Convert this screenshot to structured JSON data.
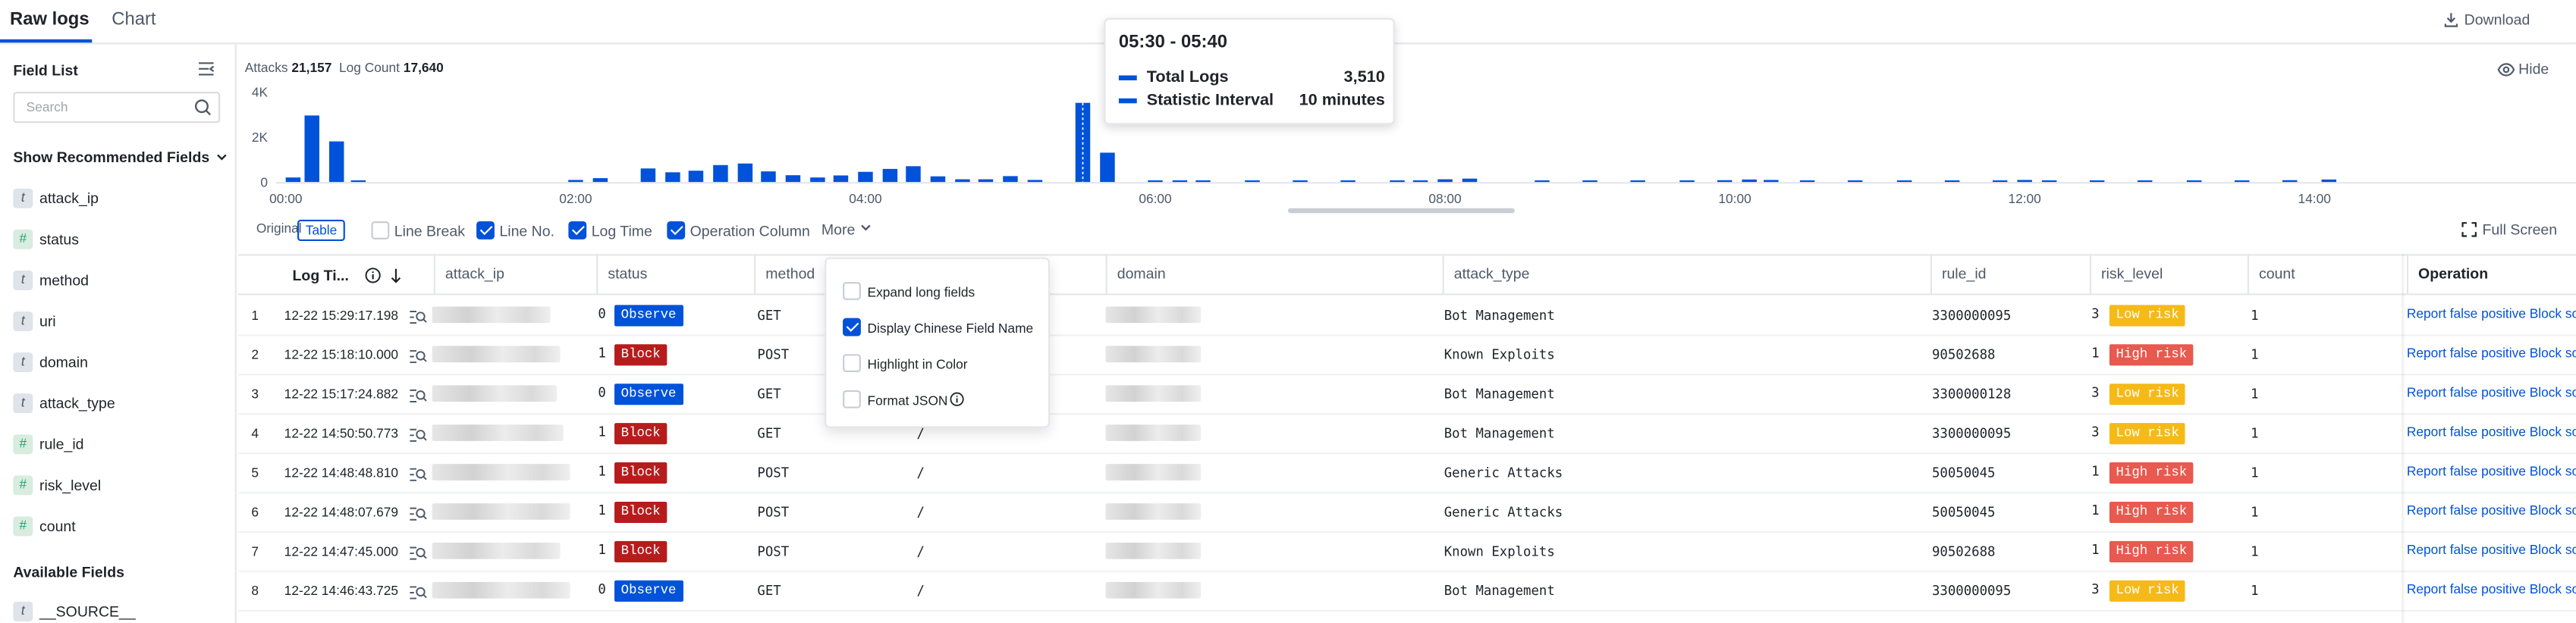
{
  "tabs": [
    {
      "label": "Raw logs",
      "active": true
    },
    {
      "label": "Chart",
      "active": false
    }
  ],
  "download_label": "Download",
  "sidebar": {
    "title": "Field List",
    "search_placeholder": "Search",
    "recommended_title": "Show Recommended Fields",
    "recommended_fields": [
      {
        "name": "attack_ip",
        "type": "t"
      },
      {
        "name": "status",
        "type": "#"
      },
      {
        "name": "method",
        "type": "t"
      },
      {
        "name": "uri",
        "type": "t"
      },
      {
        "name": "domain",
        "type": "t"
      },
      {
        "name": "attack_type",
        "type": "t"
      },
      {
        "name": "rule_id",
        "type": "#"
      },
      {
        "name": "risk_level",
        "type": "#"
      },
      {
        "name": "count",
        "type": "#"
      }
    ],
    "available_title": "Available Fields",
    "available_fields": [
      {
        "name": "__SOURCE__",
        "type": "t"
      }
    ]
  },
  "stats": {
    "attacks_label": "Attacks",
    "attacks_value": "21,157",
    "log_count_label": "Log Count",
    "log_count_value": "17,640"
  },
  "hide_label": "Hide",
  "chart_data": {
    "type": "bar",
    "y_ticks": [
      "4K",
      "2K",
      "0"
    ],
    "ylim": [
      0,
      4000
    ],
    "x_ticks": [
      "00:00",
      "02:00",
      "04:00",
      "06:00",
      "08:00",
      "10:00",
      "12:00",
      "14:00"
    ],
    "bar_color": "#0052d9",
    "highlight_color": "#0052d9",
    "highlight_index": 7,
    "bars": [
      {
        "t": 0.05,
        "v": 200
      },
      {
        "t": 0.18,
        "v": 2950
      },
      {
        "t": 0.35,
        "v": 1800
      },
      {
        "t": 0.5,
        "v": 60
      },
      {
        "t": 2.0,
        "v": 90
      },
      {
        "t": 2.17,
        "v": 170
      },
      {
        "t": 2.5,
        "v": 600
      },
      {
        "t": 2.67,
        "v": 430
      },
      {
        "t": 2.83,
        "v": 500
      },
      {
        "t": 3.0,
        "v": 750
      },
      {
        "t": 3.17,
        "v": 820
      },
      {
        "t": 3.33,
        "v": 470
      },
      {
        "t": 3.5,
        "v": 300
      },
      {
        "t": 3.67,
        "v": 200
      },
      {
        "t": 3.83,
        "v": 290
      },
      {
        "t": 4.0,
        "v": 450
      },
      {
        "t": 4.17,
        "v": 580
      },
      {
        "t": 4.33,
        "v": 700
      },
      {
        "t": 4.5,
        "v": 250
      },
      {
        "t": 4.67,
        "v": 120
      },
      {
        "t": 4.83,
        "v": 120
      },
      {
        "t": 5.0,
        "v": 260
      },
      {
        "t": 5.17,
        "v": 90
      },
      {
        "t": 5.5,
        "v": 3510
      },
      {
        "t": 5.67,
        "v": 1300
      },
      {
        "t": 6.0,
        "v": 70
      },
      {
        "t": 6.17,
        "v": 70
      },
      {
        "t": 6.33,
        "v": 60
      },
      {
        "t": 6.67,
        "v": 50
      },
      {
        "t": 7.0,
        "v": 50
      },
      {
        "t": 7.33,
        "v": 40
      },
      {
        "t": 7.67,
        "v": 40
      },
      {
        "t": 7.83,
        "v": 50
      },
      {
        "t": 8.0,
        "v": 120
      },
      {
        "t": 8.17,
        "v": 150
      },
      {
        "t": 8.67,
        "v": 60
      },
      {
        "t": 9.0,
        "v": 40
      },
      {
        "t": 9.33,
        "v": 40
      },
      {
        "t": 9.67,
        "v": 40
      },
      {
        "t": 9.93,
        "v": 80
      },
      {
        "t": 10.1,
        "v": 110
      },
      {
        "t": 10.25,
        "v": 90
      },
      {
        "t": 10.5,
        "v": 40
      },
      {
        "t": 10.83,
        "v": 40
      },
      {
        "t": 11.17,
        "v": 40
      },
      {
        "t": 11.5,
        "v": 40
      },
      {
        "t": 11.83,
        "v": 60
      },
      {
        "t": 12.0,
        "v": 90
      },
      {
        "t": 12.17,
        "v": 70
      },
      {
        "t": 12.5,
        "v": 40
      },
      {
        "t": 12.83,
        "v": 40
      },
      {
        "t": 13.17,
        "v": 40
      },
      {
        "t": 13.5,
        "v": 40
      },
      {
        "t": 13.83,
        "v": 80
      },
      {
        "t": 14.1,
        "v": 110
      }
    ]
  },
  "tooltip": {
    "title": "05:30 - 05:40",
    "rows": [
      {
        "label": "Total Logs",
        "value": "3,510"
      },
      {
        "label": "Statistic Interval",
        "value": "10 minutes"
      }
    ]
  },
  "toolbar": {
    "view_original": "Original",
    "view_table": "Table",
    "options": [
      {
        "label": "Line Break",
        "checked": false
      },
      {
        "label": "Line No.",
        "checked": true
      },
      {
        "label": "Log Time",
        "checked": true
      },
      {
        "label": "Operation Column",
        "checked": true
      }
    ],
    "more_label": "More",
    "fullscreen_label": "Full Screen"
  },
  "more_menu": [
    {
      "label": "Expand long fields",
      "checked": false
    },
    {
      "label": "Display Chinese Field Name",
      "checked": true
    },
    {
      "label": "Highlight in Color",
      "checked": false
    },
    {
      "label": "Format JSON",
      "checked": false
    }
  ],
  "table": {
    "columns": {
      "log_time": "Log Ti...",
      "attack_ip": "attack_ip",
      "status": "status",
      "method": "method",
      "domain": "domain",
      "attack_type": "attack_type",
      "rule_id": "rule_id",
      "risk_level": "risk_level",
      "count": "count",
      "operation": "Operation"
    },
    "op_text": "Report false positive Block source IP",
    "rows": [
      {
        "no": "1",
        "time": "12-22 15:29:17.198",
        "status_code": "0",
        "status_tag": "Observe",
        "method": "GET",
        "uri": "/",
        "attack_type": "Bot Management",
        "rule_id": "3300000095",
        "risk_code": "3",
        "risk_tag": "Low risk",
        "count": "1"
      },
      {
        "no": "2",
        "time": "12-22 15:18:10.000",
        "status_code": "1",
        "status_tag": "Block",
        "method": "POST",
        "uri": "/",
        "attack_type": "Known Exploits",
        "rule_id": "90502688",
        "risk_code": "1",
        "risk_tag": "High risk",
        "count": "1"
      },
      {
        "no": "3",
        "time": "12-22 15:17:24.882",
        "status_code": "0",
        "status_tag": "Observe",
        "method": "GET",
        "uri": "/",
        "attack_type": "Bot Management",
        "rule_id": "3300000128",
        "risk_code": "3",
        "risk_tag": "Low risk",
        "count": "1"
      },
      {
        "no": "4",
        "time": "12-22 14:50:50.773",
        "status_code": "1",
        "status_tag": "Block",
        "method": "GET",
        "uri": "/",
        "attack_type": "Bot Management",
        "rule_id": "3300000095",
        "risk_code": "3",
        "risk_tag": "Low risk",
        "count": "1"
      },
      {
        "no": "5",
        "time": "12-22 14:48:48.810",
        "status_code": "1",
        "status_tag": "Block",
        "method": "POST",
        "uri": "/",
        "attack_type": "Generic Attacks",
        "rule_id": "50050045",
        "risk_code": "1",
        "risk_tag": "High risk",
        "count": "1"
      },
      {
        "no": "6",
        "time": "12-22 14:48:07.679",
        "status_code": "1",
        "status_tag": "Block",
        "method": "POST",
        "uri": "/",
        "attack_type": "Generic Attacks",
        "rule_id": "50050045",
        "risk_code": "1",
        "risk_tag": "High risk",
        "count": "1"
      },
      {
        "no": "7",
        "time": "12-22 14:47:45.000",
        "status_code": "1",
        "status_tag": "Block",
        "method": "POST",
        "uri": "/",
        "attack_type": "Known Exploits",
        "rule_id": "90502688",
        "risk_code": "1",
        "risk_tag": "High risk",
        "count": "1"
      },
      {
        "no": "8",
        "time": "12-22 14:46:43.725",
        "status_code": "0",
        "status_tag": "Observe",
        "method": "GET",
        "uri": "/",
        "attack_type": "Bot Management",
        "rule_id": "3300000095",
        "risk_code": "3",
        "risk_tag": "Low risk",
        "count": "1"
      }
    ]
  }
}
